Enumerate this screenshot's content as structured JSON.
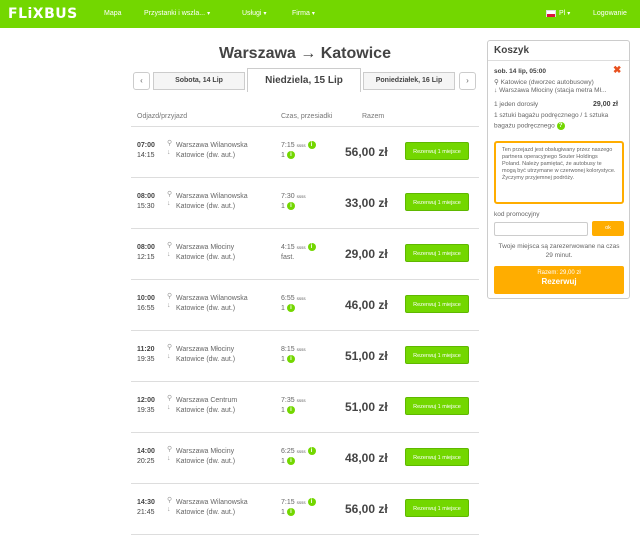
{
  "header": {
    "logo": "FLiXBUS",
    "nav": [
      {
        "label": "Mapa",
        "has_menu": false
      },
      {
        "label": "Przystanki i wszla...",
        "has_menu": true
      },
      {
        "label": "Usługi",
        "has_menu": true
      },
      {
        "label": "Firma",
        "has_menu": true
      }
    ],
    "language": "Pl",
    "login": "Logowanie",
    "accent_color": "#73d700"
  },
  "route": {
    "from": "Warszawa",
    "arrow": "→",
    "to": "Katowice"
  },
  "dates": {
    "prev": "Sobota, 14 Lip",
    "current": "Niedziela, 15 Lip",
    "next": "Poniedziałek, 16 Lip"
  },
  "columns": {
    "depart_arrive": "Odjazd/przyjazd",
    "duration": "Czas, przesiadki",
    "total": "Razem"
  },
  "rides": [
    {
      "dep": "07:00",
      "arr": "14:15",
      "from": "Warszawa Wilanowska",
      "to": "Katowice (dw. aut.)",
      "duration": "7:15",
      "transfers": "1",
      "price": "56,00 zł",
      "button": "Rezerwuj 1 miejsce"
    },
    {
      "dep": "08:00",
      "arr": "15:30",
      "from": "Warszawa Wilanowska",
      "to": "Katowice (dw. aut.)",
      "duration": "7:30",
      "transfers": "1",
      "price": "33,00 zł",
      "button": "Rezerwuj 1 miejsce"
    },
    {
      "dep": "08:00",
      "arr": "12:15",
      "from": "Warszawa Młociny",
      "to": "Katowice (dw. aut.)",
      "duration": "4:15",
      "transfers": "fast.",
      "price": "29,00 zł",
      "button": "Rezerwuj 1 miejsce"
    },
    {
      "dep": "10:00",
      "arr": "16:55",
      "from": "Warszawa Wilanowska",
      "to": "Katowice (dw. aut.)",
      "duration": "6:55",
      "transfers": "1",
      "price": "46,00 zł",
      "button": "Rezerwuj 1 miejsce"
    },
    {
      "dep": "11:20",
      "arr": "19:35",
      "from": "Warszawa Młociny",
      "to": "Katowice (dw. aut.)",
      "duration": "8:15",
      "transfers": "1",
      "price": "51,00 zł",
      "button": "Rezerwuj 1 miejsce"
    },
    {
      "dep": "12:00",
      "arr": "19:35",
      "from": "Warszawa Centrum",
      "to": "Katowice (dw. aut.)",
      "duration": "7:35",
      "transfers": "1",
      "price": "51,00 zł",
      "button": "Rezerwuj 1 miejsce"
    },
    {
      "dep": "14:00",
      "arr": "20:25",
      "from": "Warszawa Młociny",
      "to": "Katowice (dw. aut.)",
      "duration": "6:25",
      "transfers": "1",
      "price": "48,00 zł",
      "button": "Rezerwuj 1 miejsce"
    },
    {
      "dep": "14:30",
      "arr": "21:45",
      "from": "Warszawa Wilanowska",
      "to": "Katowice (dw. aut.)",
      "duration": "7:15",
      "transfers": "1",
      "price": "56,00 zł",
      "button": "Rezerwuj 1 miejsce"
    }
  ],
  "cart": {
    "title": "Koszyk",
    "date": "sob. 14 lip, 05:00",
    "from": "Katowice (dworzec autobusowy)",
    "to": "Warszawa Młociny (stacja metra Mł...",
    "passengers": "1 jeden dorosły",
    "price": "29,00 zł",
    "luggage_1": "1 sztuki bagażu podręcznego / 1 sztuka",
    "luggage_2": "bagażu podręcznego",
    "notice": "Ten przejazd jest obsługiwany przez naszego partnera operacyjnego Souter Holdings Poland. Należy pamiętać, że autobusy te mogą być utrzymane w czerwonej kolorystyce. Życzymy przyjemnej podróży.",
    "promo_label": "kod promocyjny",
    "promo_button": "ok",
    "reserved_note": "Twoje miejsca są zarezerwowane na czas 29 minut.",
    "checkout_total": "Razem: 29,00 zł",
    "checkout_label": "Rezerwuj",
    "checkout_color": "#ffad00"
  }
}
